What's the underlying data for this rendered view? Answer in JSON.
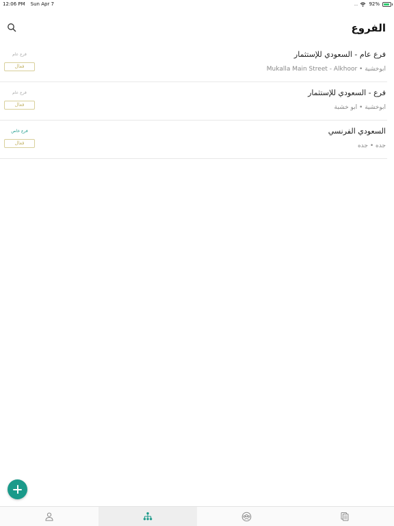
{
  "status_bar": {
    "time": "12:06 PM",
    "date": "Sun Apr 7",
    "battery": "92%",
    "battery_level": 0.92,
    "signal_dots": "....",
    "icons": [
      "wifi-icon",
      "battery-icon"
    ]
  },
  "header": {
    "title": "الفروع",
    "search_icon": "search-icon"
  },
  "branches": [
    {
      "name": "فرع عام - السعودي للإستثمار",
      "subtitle": "ابوخشية • Mukalla Main Street - Alkhoor",
      "type": "فرع عام",
      "status": "فعال"
    },
    {
      "name": "فرع - السعودي للإستثمار",
      "subtitle": "ابوخشية • ابو خشبة",
      "type": "فرع عام",
      "status": "فعال"
    },
    {
      "name": "السعودي الفرنسي",
      "subtitle": "جده • جده",
      "type": "فرع خاص",
      "status": "فعال"
    }
  ],
  "fab": {
    "icon": "plus-icon"
  },
  "tab_bar": {
    "tabs": [
      {
        "icon": "person-icon",
        "active": false
      },
      {
        "icon": "branches-icon",
        "active": true
      },
      {
        "icon": "group-icon",
        "active": false
      },
      {
        "icon": "documents-icon",
        "active": false
      }
    ]
  },
  "colors": {
    "accent": "#1a9a8a",
    "status_border": "#d8cf9a",
    "status_text": "#c4b56a",
    "subtle_text": "#888888",
    "divider": "#e8e8e8"
  }
}
